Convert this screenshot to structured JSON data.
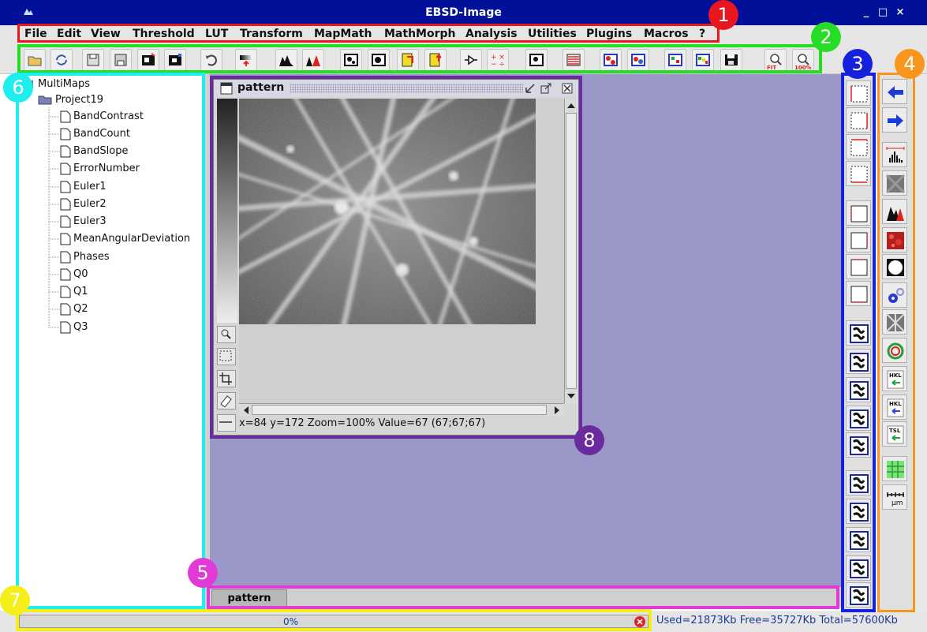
{
  "window": {
    "title": "EBSD-Image",
    "controls": [
      "_",
      "□",
      "×"
    ]
  },
  "menu": [
    "File",
    "Edit",
    "View",
    "Threshold",
    "LUT",
    "Transform",
    "MapMath",
    "MathMorph",
    "Analysis",
    "Utilities",
    "Plugins",
    "Macros",
    "?"
  ],
  "toolbar_icons": [
    "open-folder-icon",
    "refresh-icon",
    "save-icon",
    "save-as-icon",
    "map-settings-icon",
    "map-properties-icon",
    "undo-icon",
    "lut-adjust-icon",
    "histogram-icon",
    "histogram-color-icon",
    "image-bw-icon",
    "image-bw-edit-icon",
    "yellow-doc-icon",
    "yellow-doc-edit-icon",
    "arrow-plugin-icon",
    "math-operators-icon",
    "image-bw-small-icon",
    "stripe-map-icon",
    "phase-map-icon",
    "phase-map2-icon",
    "multicolor-map-icon",
    "multicolor-map2-icon",
    "save-map-icon",
    "zoom-fit-icon",
    "zoom-100-icon"
  ],
  "toolbar_extra_text": {
    "fit": "FIT",
    "z100": "100%"
  },
  "tree": {
    "root": "MultiMaps",
    "project": "Project19",
    "items": [
      "BandContrast",
      "BandCount",
      "BandSlope",
      "ErrorNumber",
      "Euler1",
      "Euler2",
      "Euler3",
      "MeanAngularDeviation",
      "Phases",
      "Q0",
      "Q1",
      "Q2",
      "Q3"
    ]
  },
  "image_window": {
    "title": "pattern",
    "status": "x=84  y=172  Zoom=100%  Value=67 (67;67;67)"
  },
  "tabs": [
    "pattern"
  ],
  "status": {
    "progress_text": "0%",
    "progress": 0,
    "memory": "Used=21873Kb  Free=35727Kb  Total=57600Kb"
  },
  "right_tools_1": [
    "roi-1-icon",
    "roi-2-icon",
    "roi-3-icon",
    "roi-4-icon",
    "roi-5-icon",
    "roi-6-icon",
    "roi-7-icon",
    "roi-8-icon",
    "map-1-icon",
    "map-2-icon",
    "map-3-icon",
    "map-4-icon",
    "map-5-icon",
    "map-6-icon",
    "map-7-icon",
    "map-8-icon",
    "map-9-icon",
    "map-10-icon"
  ],
  "right_tools_2": [
    "arrow-left-icon",
    "arrow-right-icon",
    "histogram-range-icon",
    "noise-filter-icon",
    "histogram-icon",
    "random-map-icon",
    "circle-icon",
    "gears-icon",
    "kikuchi-icon",
    "ring-pattern-icon",
    "hkl-import-icon",
    "hkl-export-icon",
    "tsl-import-icon",
    "grid-icon",
    "micron-bar-icon"
  ],
  "right_tool_text": {
    "hkl": "HKL",
    "tsl": "TSL",
    "um": "µm"
  },
  "annotations": [
    {
      "num": "1",
      "color": "#e8161f"
    },
    {
      "num": "2",
      "color": "#26dd26"
    },
    {
      "num": "3",
      "color": "#1621dd"
    },
    {
      "num": "4",
      "color": "#f7951d"
    },
    {
      "num": "5",
      "color": "#e13ad7"
    },
    {
      "num": "6",
      "color": "#1eeeed"
    },
    {
      "num": "7",
      "color": "#f6ee19"
    },
    {
      "num": "8",
      "color": "#6a2b9e"
    }
  ]
}
